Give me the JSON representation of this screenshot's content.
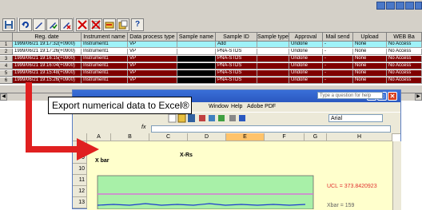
{
  "toolbar": {
    "buttons": [
      "save-icon",
      "refresh-icon",
      "edit-icon",
      "edit-check-icon",
      "edit-cross-icon",
      "delete-icon",
      "delete-all-icon",
      "folder-icon",
      "open-icon",
      "help-icon"
    ],
    "help_label": "?"
  },
  "grid": {
    "headers": [
      "Reg. date",
      "Instrument name",
      "Data process type",
      "Sample name",
      "Sample ID",
      "Sample type",
      "Approval",
      "Mail send",
      "Upload",
      "WEB Ba"
    ],
    "rows": [
      {
        "num": "1",
        "date": "1999/06/21 19:17:32(+0900)",
        "instrument": "Instrument1",
        "process": "VP",
        "sample_name": "",
        "sample_id": "Add",
        "sample_type": "",
        "approval": "Undone",
        "mail": "-",
        "upload": "None",
        "web": "No Access"
      },
      {
        "num": "2",
        "date": "1999/06/21 19:17:26(+0900)",
        "instrument": "Instrument1",
        "process": "VP",
        "sample_name": "",
        "sample_id": "PNA-STDS",
        "sample_type": "",
        "approval": "Undone",
        "mail": "-",
        "upload": "None",
        "web": "No Access"
      },
      {
        "num": "3",
        "date": "1999/06/21 19:16:15(+0900)",
        "instrument": "Instrument1",
        "process": "VP",
        "sample_name": "",
        "sample_id": "PNA-STDS",
        "sample_type": "",
        "approval": "Undone",
        "mail": "-",
        "upload": "None",
        "web": "No Access"
      },
      {
        "num": "4",
        "date": "1999/06/21 19:16:04(+0900)",
        "instrument": "Instrument1",
        "process": "VP",
        "sample_name": "",
        "sample_id": "PNA-STDS",
        "sample_type": "",
        "approval": "Undone",
        "mail": "-",
        "upload": "None",
        "web": "No Access"
      },
      {
        "num": "5",
        "date": "1999/06/21 19:15:48(+0900)",
        "instrument": "Instrument1",
        "process": "VP",
        "sample_name": "",
        "sample_id": "PNA-STDS",
        "sample_type": "",
        "approval": "Undone",
        "mail": "-",
        "upload": "None",
        "web": "No Access"
      },
      {
        "num": "6",
        "date": "1999/06/21 19:15:26(+0900)",
        "instrument": "Instrument1",
        "process": "VP",
        "sample_name": "",
        "sample_id": "PNA-STDS",
        "sample_type": "",
        "approval": "Undone",
        "mail": "-",
        "upload": "None",
        "web": "No Access"
      }
    ]
  },
  "callout": {
    "text": "Export numerical data to Excel®"
  },
  "excel": {
    "menu": [
      "Window",
      "Help",
      "Adobe PDF"
    ],
    "help_placeholder": "Type a question for help",
    "font": "Arial",
    "fx": "fx",
    "columns": [
      "A",
      "B",
      "C",
      "D",
      "E",
      "F",
      "G",
      "H"
    ],
    "rows": [
      "8",
      "9",
      "10",
      "11",
      "12",
      "13"
    ],
    "chart_title": "X-Rs",
    "chart_label": "X bar",
    "ucl": "UCL = 373.8420923",
    "xbar": "Xbar = 159"
  },
  "colors": {
    "cyan_row": "#9ff2f8",
    "selected_row": "#800000",
    "arrow": "#e02020",
    "excel_title": "#2a58c0"
  }
}
